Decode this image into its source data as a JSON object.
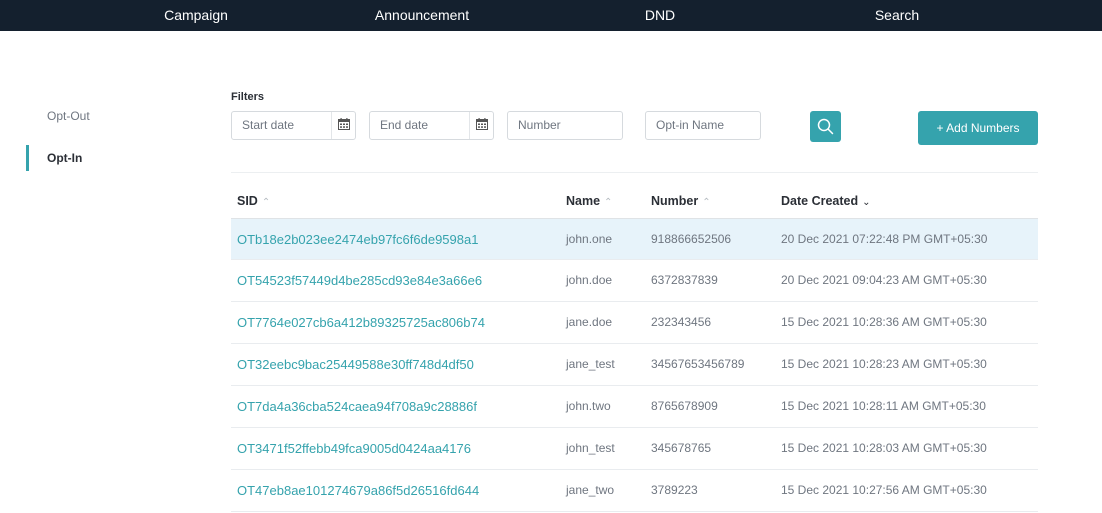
{
  "nav": {
    "items": [
      "Campaign",
      "Announcement",
      "DND",
      "Search"
    ]
  },
  "sidebar": {
    "items": [
      {
        "label": "Opt-Out",
        "active": false
      },
      {
        "label": "Opt-In",
        "active": true
      }
    ]
  },
  "filters": {
    "title": "Filters",
    "start_date_placeholder": "Start date",
    "end_date_placeholder": "End date",
    "number_placeholder": "Number",
    "optin_name_placeholder": "Opt-in Name",
    "add_button_label": "+ Add Numbers",
    "search_icon": "search-icon",
    "calendar_icon": "calendar-icon"
  },
  "table": {
    "columns": [
      {
        "label": "SID",
        "sort": "^"
      },
      {
        "label": "Name",
        "sort": "^"
      },
      {
        "label": "Number",
        "sort": "^"
      },
      {
        "label": "Date Created",
        "sort": "v"
      }
    ],
    "rows": [
      {
        "sid": "OTb18e2b023ee2474eb97fc6f6de9598a1",
        "name": "john.one",
        "number": "918866652506",
        "date": "20 Dec 2021 07:22:48 PM GMT+05:30",
        "selected": true
      },
      {
        "sid": "OT54523f57449d4be285cd93e84e3a66e6",
        "name": "john.doe",
        "number": "6372837839",
        "date": "20 Dec 2021 09:04:23 AM GMT+05:30",
        "selected": false
      },
      {
        "sid": "OT7764e027cb6a412b89325725ac806b74",
        "name": "jane.doe",
        "number": "232343456",
        "date": "15 Dec 2021 10:28:36 AM GMT+05:30",
        "selected": false
      },
      {
        "sid": "OT32eebc9bac25449588e30ff748d4df50",
        "name": "jane_test",
        "number": "34567653456789",
        "date": "15 Dec 2021 10:28:23 AM GMT+05:30",
        "selected": false
      },
      {
        "sid": "OT7da4a36cba524caea94f708a9c28886f",
        "name": "john.two",
        "number": "8765678909",
        "date": "15 Dec 2021 10:28:11 AM GMT+05:30",
        "selected": false
      },
      {
        "sid": "OT3471f52ffebb49fca9005d0424aa4176",
        "name": "john_test",
        "number": "345678765",
        "date": "15 Dec 2021 10:28:03 AM GMT+05:30",
        "selected": false
      },
      {
        "sid": "OT47eb8ae101274679a86f5d26516fd644",
        "name": "jane_two",
        "number": "3789223",
        "date": "15 Dec 2021 10:27:56 AM GMT+05:30",
        "selected": false
      }
    ]
  },
  "colors": {
    "accent": "#35a3ad",
    "nav_bg": "#14202e",
    "selected_row": "#e7f3fa"
  }
}
